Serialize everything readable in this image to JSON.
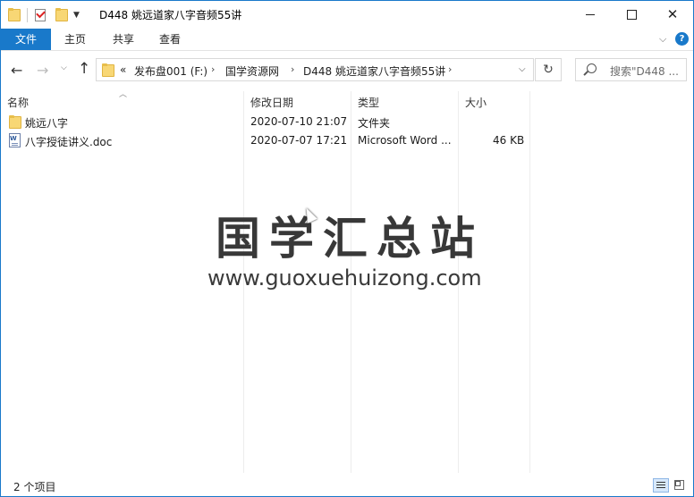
{
  "window": {
    "title": "D448 姚远道家八字音频55讲"
  },
  "ribbon": {
    "tabs": [
      "文件",
      "主页",
      "共享",
      "查看"
    ]
  },
  "address": {
    "overflow": "«",
    "segments": [
      "发布盘001 (F:)",
      "国学资源网",
      "D448 姚远道家八字音频55讲"
    ]
  },
  "search": {
    "placeholder": "搜索\"D448 ..."
  },
  "columns": [
    "名称",
    "修改日期",
    "类型",
    "大小"
  ],
  "files": [
    {
      "name": "姚远八字",
      "modified": "2020-07-10 21:07",
      "type": "文件夹",
      "size": "",
      "icon": "folder-icon"
    },
    {
      "name": "八字授徒讲义.doc",
      "modified": "2020-07-07 17:21",
      "type": "Microsoft Word ...",
      "size": "46 KB",
      "icon": "word-doc-icon"
    }
  ],
  "watermark": {
    "title": "国学汇总站",
    "url": "www.guoxuehuizong.com"
  },
  "status": {
    "count": "2 个项目"
  },
  "colors": {
    "accent": "#1979ca",
    "folder": "#f8d775"
  }
}
